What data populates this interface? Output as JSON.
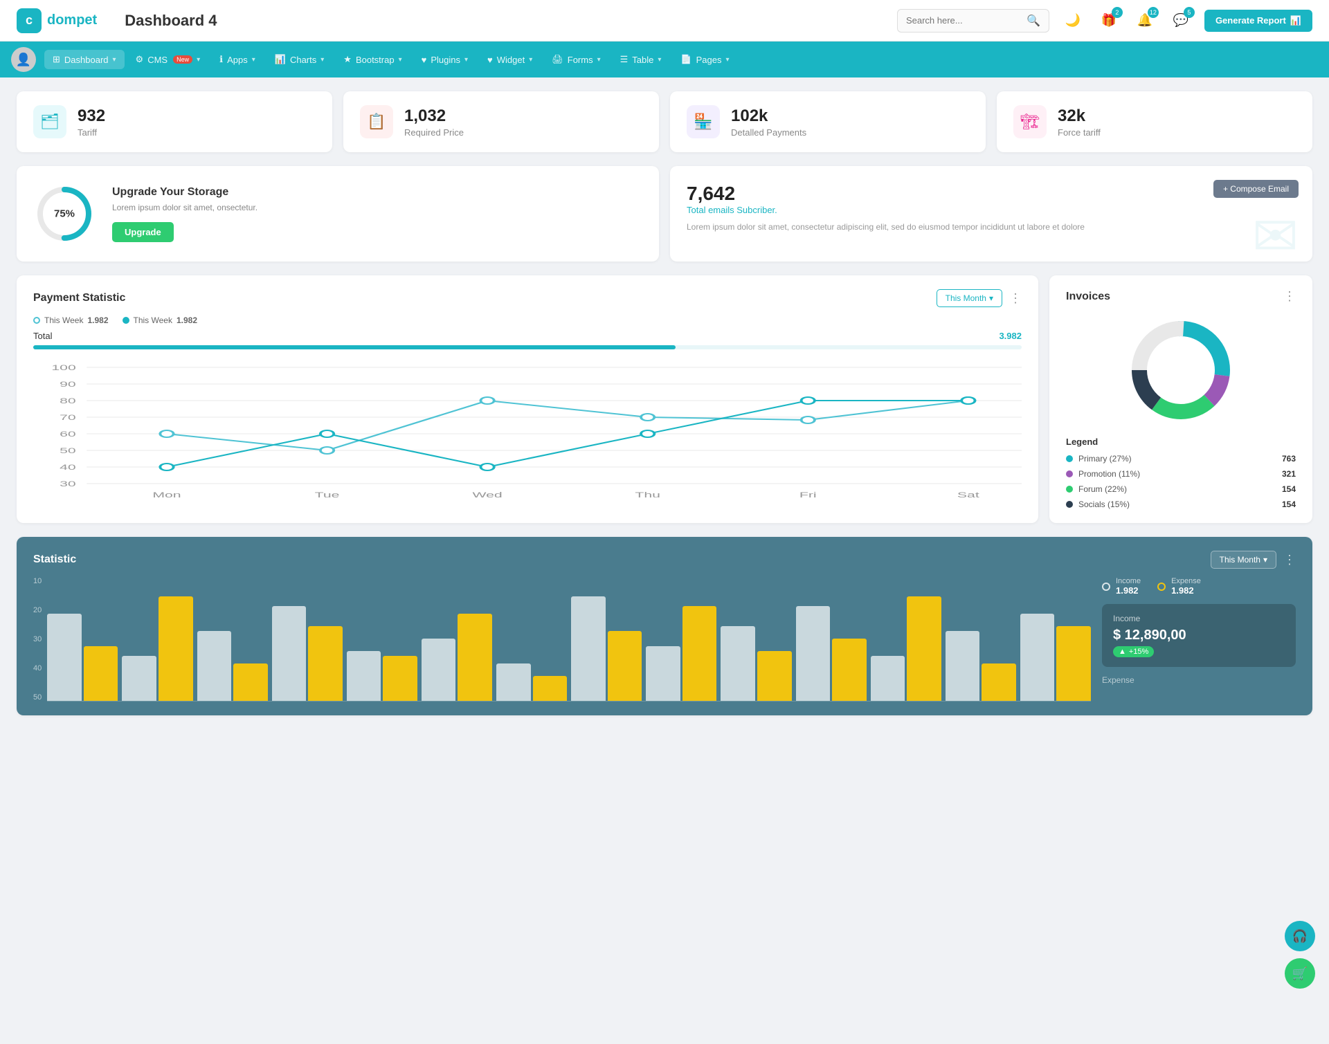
{
  "app": {
    "logo": "c",
    "name": "dompet",
    "title": "Dashboard 4",
    "search_placeholder": "Search here..."
  },
  "header": {
    "generate_report": "Generate Report",
    "badge_gift": "2",
    "badge_bell": "12",
    "badge_chat": "5"
  },
  "nav": {
    "items": [
      {
        "label": "Dashboard",
        "icon": "⊞",
        "active": true,
        "arrow": true
      },
      {
        "label": "CMS",
        "icon": "⚙",
        "badge": "New",
        "arrow": true
      },
      {
        "label": "Apps",
        "icon": "ℹ",
        "arrow": true
      },
      {
        "label": "Charts",
        "icon": "📊",
        "arrow": true
      },
      {
        "label": "Bootstrap",
        "icon": "★",
        "arrow": true
      },
      {
        "label": "Plugins",
        "icon": "♥",
        "arrow": true
      },
      {
        "label": "Widget",
        "icon": "♥",
        "arrow": true
      },
      {
        "label": "Forms",
        "icon": "🖨",
        "arrow": true
      },
      {
        "label": "Table",
        "icon": "☰",
        "arrow": true
      },
      {
        "label": "Pages",
        "icon": "📄",
        "arrow": true
      }
    ]
  },
  "stats": [
    {
      "value": "932",
      "label": "Tariff",
      "icon": "🗂",
      "color": "teal"
    },
    {
      "value": "1,032",
      "label": "Required Price",
      "icon": "📋",
      "color": "red"
    },
    {
      "value": "102k",
      "label": "Detalled Payments",
      "icon": "🏪",
      "color": "purple"
    },
    {
      "value": "32k",
      "label": "Force tariff",
      "icon": "🏗",
      "color": "pink"
    }
  ],
  "storage": {
    "percent": "75%",
    "title": "Upgrade Your Storage",
    "description": "Lorem ipsum dolor sit amet, onsectetur.",
    "button": "Upgrade"
  },
  "email": {
    "count": "7,642",
    "subtitle": "Total emails Subcriber.",
    "description": "Lorem ipsum dolor sit amet, consectetur adipiscing elit, sed do eiusmod tempor incididunt ut labore et dolore",
    "compose_btn": "+ Compose Email"
  },
  "payment": {
    "title": "Payment Statistic",
    "filter": "This Month",
    "legend1_label": "This Week",
    "legend1_value": "1.982",
    "legend2_label": "This Week",
    "legend2_value": "1.982",
    "total_label": "Total",
    "total_value": "3.982",
    "total_pct": 65,
    "x_labels": [
      "Mon",
      "Tue",
      "Wed",
      "Thu",
      "Fri",
      "Sat"
    ],
    "y_labels": [
      "100",
      "90",
      "80",
      "70",
      "60",
      "50",
      "40",
      "30"
    ],
    "line1": [
      60,
      50,
      80,
      65,
      63,
      88
    ],
    "line2": [
      40,
      68,
      40,
      60,
      88,
      88
    ]
  },
  "invoices": {
    "title": "Invoices",
    "legend": [
      {
        "label": "Primary (27%)",
        "value": "763",
        "color": "#1ab5c3"
      },
      {
        "label": "Promotion (11%)",
        "value": "321",
        "color": "#9b59b6"
      },
      {
        "label": "Forum (22%)",
        "value": "154",
        "color": "#2ecc71"
      },
      {
        "label": "Socials (15%)",
        "value": "154",
        "color": "#2c3e50"
      }
    ],
    "legend_title": "Legend"
  },
  "statistic": {
    "title": "Statistic",
    "filter": "This Month",
    "y_labels": [
      "50",
      "40",
      "30",
      "20",
      "10"
    ],
    "income_label": "Income",
    "income_value": "1.982",
    "expense_label": "Expense",
    "expense_value": "1.982",
    "income_box_label": "Income",
    "income_box_value": "$ 12,890,00",
    "income_badge": "+15%",
    "expense_box_label": "Expense",
    "bars": [
      [
        35,
        22
      ],
      [
        18,
        42
      ],
      [
        28,
        15
      ],
      [
        38,
        30
      ],
      [
        20,
        18
      ],
      [
        25,
        35
      ],
      [
        15,
        10
      ],
      [
        42,
        28
      ],
      [
        22,
        38
      ],
      [
        30,
        20
      ],
      [
        38,
        25
      ],
      [
        18,
        42
      ],
      [
        28,
        15
      ],
      [
        35,
        30
      ]
    ]
  }
}
